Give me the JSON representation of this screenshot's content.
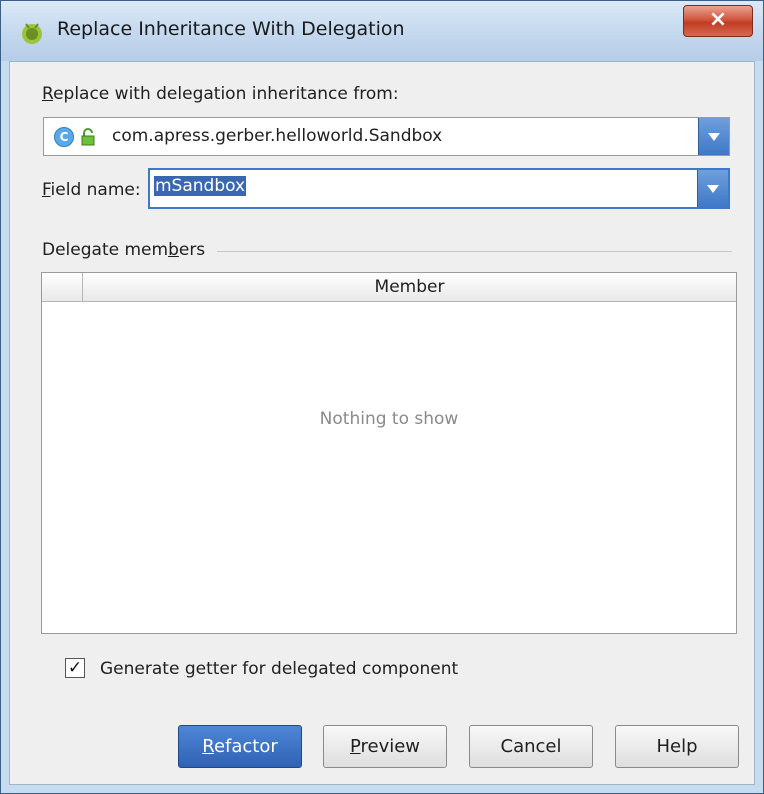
{
  "window": {
    "title": "Replace Inheritance With Delegation",
    "close_label": "×"
  },
  "form": {
    "replace_label_pre": "R",
    "replace_label_post": "eplace with delegation inheritance from:",
    "class_value": "com.apress.gerber.helloworld.Sandbox",
    "field_label_pre": "F",
    "field_label_post": "ield name:",
    "field_value": "mSandbox"
  },
  "delegate": {
    "section_label_pre": "Delegate mem",
    "section_label_u": "b",
    "section_label_post": "ers",
    "column_header": "Member",
    "empty_text": "Nothing to show"
  },
  "options": {
    "getter_checked": true,
    "getter_label_pre": "Generate ",
    "getter_label_u": "g",
    "getter_label_post": "etter for delegated component"
  },
  "buttons": {
    "refactor_u": "R",
    "refactor_rest": "efactor",
    "preview_u": "P",
    "preview_rest": "review",
    "cancel": "Cancel",
    "help": "Help"
  },
  "icons": {
    "app": "android-icon",
    "class": "class-icon",
    "lock": "lock-icon",
    "close": "close-icon",
    "dropdown": "chevron-down-icon",
    "check": "check-icon"
  },
  "colors": {
    "accent": "#3f78c8",
    "primary_button": "#2f62b4",
    "close_button": "#c23c23"
  }
}
